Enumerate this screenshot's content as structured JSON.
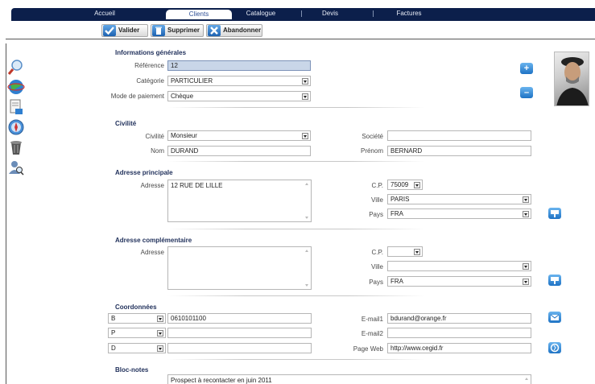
{
  "nav": {
    "tabs": [
      {
        "label": "Accueil",
        "active": false
      },
      {
        "label": "Clients",
        "active": true
      },
      {
        "label": "Catalogue",
        "active": false
      },
      {
        "label": "Devis",
        "active": false
      },
      {
        "label": "Factures",
        "active": false
      }
    ]
  },
  "toolbar": {
    "validate_label": "Valider",
    "delete_label": "Supprimer",
    "cancel_label": "Abandonner"
  },
  "general": {
    "title": "Informations générales",
    "reference_label": "Référence",
    "reference_value": "12",
    "category_label": "Catégorie",
    "category_value": "PARTICULIER",
    "payment_label": "Mode de paiement",
    "payment_value": "Chèque"
  },
  "civility": {
    "title": "Civilité",
    "civility_label": "Civilité",
    "civility_value": "Monsieur",
    "company_label": "Société",
    "company_value": "",
    "lastname_label": "Nom",
    "lastname_value": "DURAND",
    "firstname_label": "Prénom",
    "firstname_value": "BERNARD"
  },
  "main_address": {
    "title": "Adresse principale",
    "address_label": "Adresse",
    "address_value": "12 RUE DE LILLE",
    "zip_label": "C.P.",
    "zip_value": "75009",
    "city_label": "Ville",
    "city_value": "PARIS",
    "country_label": "Pays",
    "country_value": "FRA"
  },
  "extra_address": {
    "title": "Adresse complémentaire",
    "address_label": "Adresse",
    "address_value": "",
    "zip_label": "C.P.",
    "zip_value": "",
    "city_label": "Ville",
    "city_value": "",
    "country_label": "Pays",
    "country_value": "FRA"
  },
  "contact": {
    "title": "Coordonnées",
    "phones": [
      {
        "type": "B",
        "value": "0610101100"
      },
      {
        "type": "P",
        "value": ""
      },
      {
        "type": "D",
        "value": ""
      }
    ],
    "email1_label": "E-mail1",
    "email1_value": "bdurand@orange.fr",
    "email2_label": "E-mail2",
    "email2_value": "",
    "web_label": "Page Web",
    "web_value": "http://www.cegid.fr"
  },
  "notes": {
    "title": "Bloc-notes",
    "value": "Prospect à recontacter en juin 2011"
  },
  "icons": {
    "sidebar": [
      "search-icon",
      "globe-icon",
      "document-icon",
      "compass-icon",
      "trash-icon",
      "user-search-icon"
    ],
    "photo_add": "plus-icon",
    "photo_remove": "minus-icon"
  },
  "colors": {
    "nav_bg": "#0c1f4b",
    "accent_blue": "#1e73c4",
    "section_title": "#1f2f5a"
  }
}
